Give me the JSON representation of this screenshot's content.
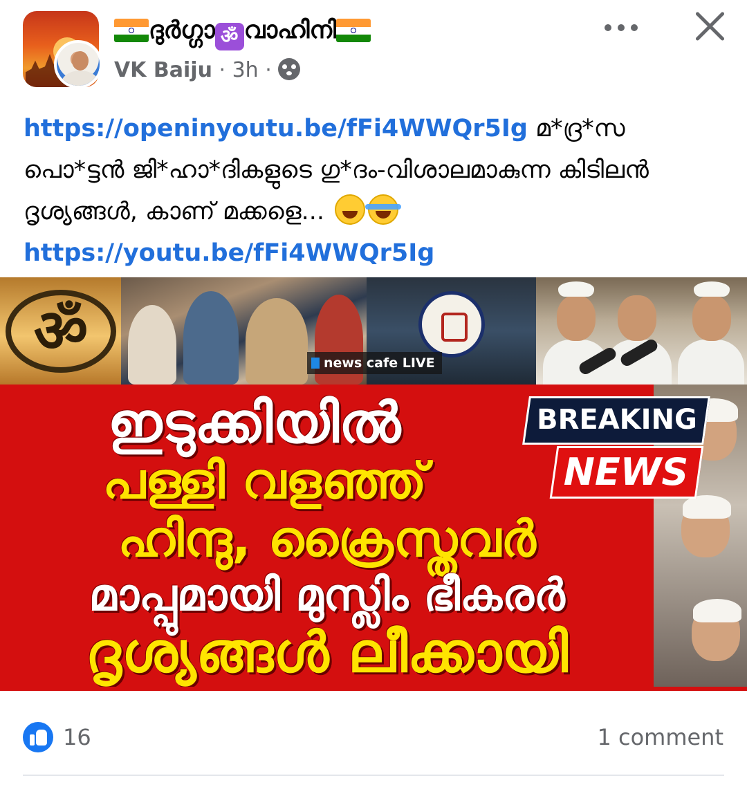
{
  "header": {
    "group_name": "ദുർഗ്ഗാ",
    "group_name_suffix": "വാഹിനി",
    "om_symbol": "ॐ",
    "author": "VK Baiju",
    "separator": "·",
    "timestamp": "3h",
    "audience_icon": "group-audience-icon",
    "flag_icon": "india-flag-icon"
  },
  "post": {
    "link_1": "https://openinyoutu.be/fFi4WWQr5Ig",
    "text": " മ*ദ്ര*സ പൊ*ട്ടൻ ജി*ഹാ*ദികളുടെ ഗു*ദം-വിശാലമാകുന്ന കിടിലൻ ദൃശ്യങ്ങൾ, കാണ് മക്കളെ...",
    "emojis": [
      "grinning-face-emoji",
      "face-with-tears-of-joy-emoji"
    ],
    "link_2": "https://youtu.be/fFi4WWQr5Ig"
  },
  "thumbnail": {
    "om_symbol": "ॐ",
    "channel_tag": "news cafe LIVE",
    "breaking_label": "BREAKING",
    "news_label": "NEWS",
    "headline": [
      "ഇടുക്കിയിൽ",
      "പള്ളി വളഞ്ഞ്",
      "ഹിന്ദു, ക്രൈസ്തവർ",
      "മാപ്പുമായി മുസ്ലിം ഭീകരർ",
      "ദൃശ്യങ്ങൾ ലീക്കായി"
    ],
    "colors": {
      "background": "#d40f0f",
      "headline_yellow": "#ffe400",
      "breaking_navy": "#0d1b3a"
    }
  },
  "footer": {
    "like_count": "16",
    "comment_count": "1 comment",
    "like_color": "#1877f2"
  }
}
